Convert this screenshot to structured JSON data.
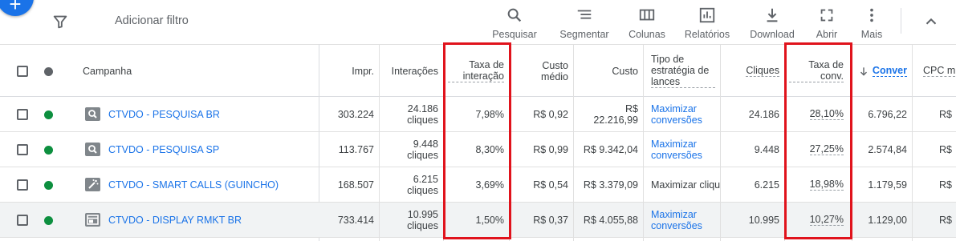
{
  "toolbar": {
    "add_filter": "Adicionar filtro",
    "tools": [
      {
        "icon": "search-icon",
        "label": "Pesquisar"
      },
      {
        "icon": "segment-icon",
        "label": "Segmentar"
      },
      {
        "icon": "columns-icon",
        "label": "Colunas"
      },
      {
        "icon": "reports-icon",
        "label": "Relatórios"
      },
      {
        "icon": "download-icon",
        "label": "Download"
      },
      {
        "icon": "fullscreen-icon",
        "label": "Abrir"
      },
      {
        "icon": "more-vert-icon",
        "label": "Mais"
      }
    ]
  },
  "table": {
    "headers": {
      "campaign": "Campanha",
      "impr": "Impr.",
      "interactions": "Interações",
      "interaction_rate": "Taxa de interação",
      "avg_cost": "Custo médio",
      "cost": "Custo",
      "bid_strategy": "Tipo de estratégia de lances",
      "clicks": "Cliques",
      "conv_rate": "Taxa de conv.",
      "conversions": "Conver",
      "cpc": "CPC m"
    },
    "rows": [
      {
        "campaign": "CTVDO - PESQUISA BR",
        "type_icon": "search-campaign-icon",
        "impr": "303.224",
        "interactions": "24.186",
        "interactions_unit": "cliques",
        "interaction_rate": "7,98%",
        "avg_cost": "R$ 0,92",
        "cost": "R$ 22.216,99",
        "bid_strategy": "Maximizar conversões",
        "clicks": "24.186",
        "conv_rate": "28,10%",
        "conversions": "6.796,22",
        "cpc": "R$"
      },
      {
        "campaign": "CTVDO - PESQUISA SP",
        "type_icon": "search-campaign-icon",
        "impr": "113.767",
        "interactions": "9.448",
        "interactions_unit": "cliques",
        "interaction_rate": "8,30%",
        "avg_cost": "R$ 0,99",
        "cost": "R$ 9.342,04",
        "bid_strategy": "Maximizar conversões",
        "clicks": "9.448",
        "conv_rate": "27,25%",
        "conversions": "2.574,84",
        "cpc": "R$"
      },
      {
        "campaign": "CTVDO - SMART CALLS (GUINCHO)",
        "type_icon": "smart-campaign-icon",
        "impr": "168.507",
        "interactions": "6.215",
        "interactions_unit": "cliques",
        "interaction_rate": "3,69%",
        "avg_cost": "R$ 0,54",
        "cost": "R$ 3.379,09",
        "bid_strategy": "Maximizar clique",
        "clicks": "6.215",
        "conv_rate": "18,98%",
        "conversions": "1.179,59",
        "cpc": "R$"
      },
      {
        "campaign": "CTVDO - DISPLAY RMKT BR",
        "type_icon": "display-campaign-icon",
        "impr": "733.414",
        "interactions": "10.995",
        "interactions_unit": "cliques",
        "interaction_rate": "1,50%",
        "avg_cost": "R$ 0,37",
        "cost": "R$ 4.055,88",
        "bid_strategy": "Maximizar conversões",
        "clicks": "10.995",
        "conv_rate": "10,27%",
        "conversions": "1.129,00",
        "cpc": "R$"
      }
    ]
  },
  "colors": {
    "accent": "#1a73e8",
    "status_enabled": "#0d8f3f",
    "highlight": "#e0131c"
  }
}
